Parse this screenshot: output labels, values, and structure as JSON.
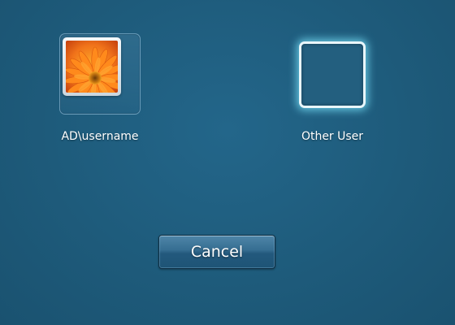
{
  "accounts": [
    {
      "label": "AD\\username",
      "icon": "flower-user-picture-icon",
      "selected": true
    },
    {
      "label": "Other User",
      "icon": "blank-user-picture-icon",
      "selected": false
    }
  ],
  "actions": {
    "cancel_label": "Cancel"
  },
  "colors": {
    "background": "#1f5c7c",
    "tile_glow": "#78e1fa",
    "button": "#356d91"
  }
}
